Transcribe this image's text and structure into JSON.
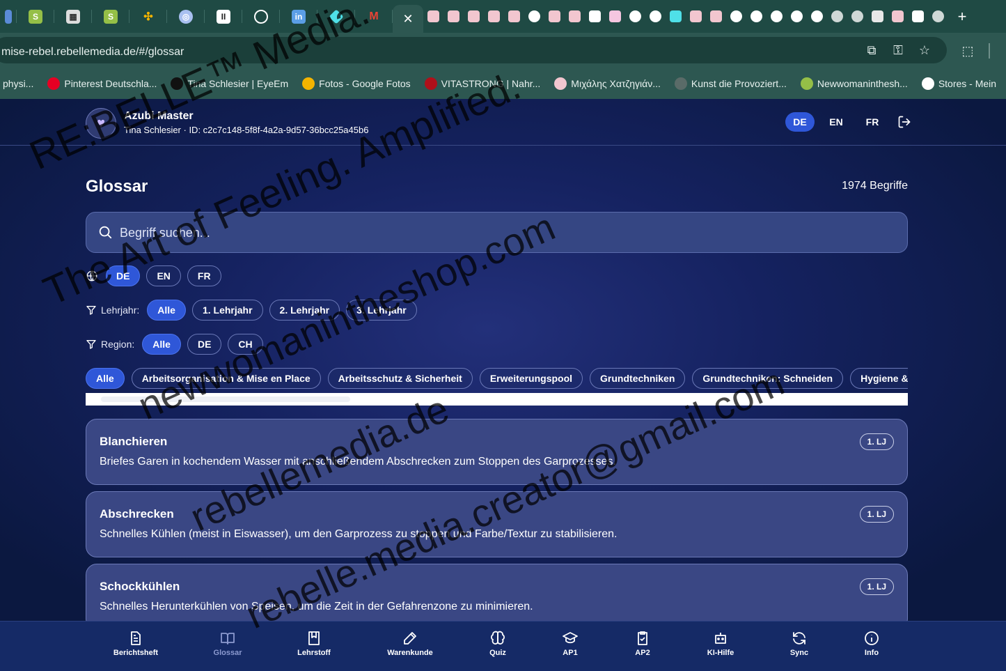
{
  "browser": {
    "url": "mise-rebel.rebellemedia.de/#/glossar",
    "bookmarks": [
      {
        "label": "physi...",
        "icon": "page-icon",
        "color": "#6f8f8a"
      },
      {
        "label": "Pinterest Deutschla...",
        "icon": "pinterest-icon",
        "color": "#e60023"
      },
      {
        "label": "Tina Schlesier | EyeEm",
        "icon": "eyeem-icon",
        "color": "#111111"
      },
      {
        "label": "Fotos - Google Fotos",
        "icon": "google-photos-icon",
        "color": "#f4b400"
      },
      {
        "label": "VITASTRONG | Nahr...",
        "icon": "vitastrong-icon",
        "color": "#b0101a"
      },
      {
        "label": "Μιχάλης Χατζηγιάν...",
        "icon": "heart-icon",
        "color": "#f2c6cf"
      },
      {
        "label": "Kunst die Provoziert...",
        "icon": "globe-icon",
        "color": "#5a6b68"
      },
      {
        "label": "Newwomaninthesh...",
        "icon": "shopify-icon",
        "color": "#95bf47"
      },
      {
        "label": "Stores - Mein",
        "icon": "stores-icon",
        "color": "#ffffff"
      }
    ]
  },
  "app": {
    "title": "Azubi Master",
    "subtitle": "Tina Schlesier · ID: c2c7c148-5f8f-4a2a-9d57-36bcc25a45b6",
    "langs": [
      "DE",
      "EN",
      "FR"
    ],
    "active_lang": "DE"
  },
  "glossar": {
    "title": "Glossar",
    "count": "1974 Begriffe",
    "search_placeholder": "Begriff suchen...",
    "term_langs": [
      "DE",
      "EN",
      "FR"
    ],
    "lehrjahr_label": "Lehrjahr:",
    "lehrjahr": [
      "Alle",
      "1. Lehrjahr",
      "2. Lehrjahr",
      "3. Lehrjahr"
    ],
    "region_label": "Region:",
    "region": [
      "Alle",
      "DE",
      "CH"
    ],
    "categories": [
      "Alle",
      "Arbeitsorganisation & Mise en Place",
      "Arbeitsschutz & Sicherheit",
      "Erweiterungspool",
      "Grundtechniken",
      "Grundtechniken: Schneiden",
      "Hygiene & HACCP"
    ],
    "terms": [
      {
        "term": "Blanchieren",
        "definition": "Briefes Garen in kochendem Wasser mit anschließendem Abschrecken zum Stoppen des Garprozesses.",
        "badge": "1. LJ"
      },
      {
        "term": "Abschrecken",
        "definition": "Schnelles Kühlen (meist in Eiswasser), um den Garprozess zu stoppen und Farbe/Textur zu stabilisieren.",
        "badge": "1. LJ"
      },
      {
        "term": "Schockkühlen",
        "definition": "Schnelles Herunterkühlen von Speisen, um die Zeit in der Gefahrenzone zu minimieren.",
        "badge": "1. LJ"
      }
    ]
  },
  "nav": [
    {
      "label": "Berichtsheft",
      "icon": "document-icon"
    },
    {
      "label": "Glossar",
      "icon": "book-open-icon"
    },
    {
      "label": "Lehrstoff",
      "icon": "bookmark-book-icon"
    },
    {
      "label": "Warenkunde",
      "icon": "pen-icon"
    },
    {
      "label": "Quiz",
      "icon": "brain-icon"
    },
    {
      "label": "AP1",
      "icon": "graduation-cap-icon"
    },
    {
      "label": "AP2",
      "icon": "clipboard-check-icon"
    },
    {
      "label": "KI-Hilfe",
      "icon": "robot-icon"
    },
    {
      "label": "Sync",
      "icon": "sync-icon"
    },
    {
      "label": "Info",
      "icon": "info-icon"
    }
  ],
  "watermark": [
    "RE:BELLE™ Media.",
    "The Art of Feeling. Amplified.",
    "newwomanintheshop.com",
    "rebellemedia.de",
    "rebelle.media.creator@gmail.com"
  ]
}
